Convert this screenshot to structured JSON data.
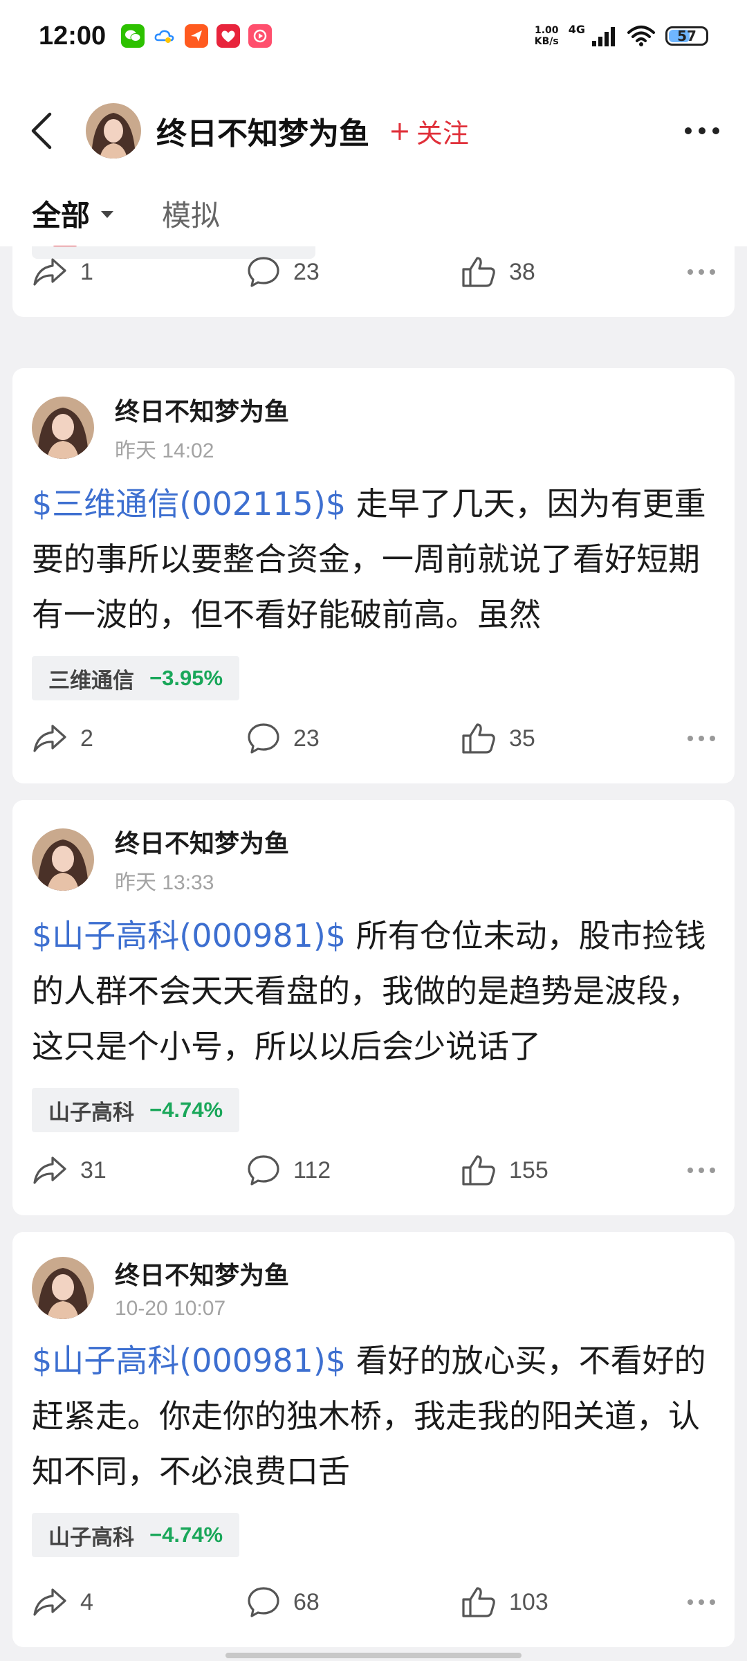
{
  "status_bar": {
    "time": "12:00",
    "net_speed_value": "1.00",
    "net_speed_unit": "KB/s",
    "network": "4G",
    "battery": "57",
    "battery_level": 0.57
  },
  "header": {
    "title": "终日不知梦为鱼",
    "follow_label": "关注",
    "follow_prefix": "+"
  },
  "tabs": [
    {
      "label": "全部",
      "active": true
    },
    {
      "label": "模拟",
      "active": false
    }
  ],
  "partial_post": {
    "shares": "1",
    "comments": "23",
    "likes": "38"
  },
  "posts": [
    {
      "author": "终日不知梦为鱼",
      "time": "昨天 14:02",
      "stock_link": "$三维通信(002115)$",
      "text": " 走早了几天，因为有更重要的事所以要整合资金，一周前就说了看好短期有一波的，但不看好能破前高。虽然",
      "tag_name": "三维通信",
      "tag_change": "−3.95%",
      "shares": "2",
      "comments": "23",
      "likes": "35"
    },
    {
      "author": "终日不知梦为鱼",
      "time": "昨天 13:33",
      "stock_link": "$山子高科(000981)$",
      "text": " 所有仓位未动，股市捡钱的人群不会天天看盘的，我做的是趋势是波段，这只是个小号，所以以后会少说话了",
      "tag_name": "山子高科",
      "tag_change": "−4.74%",
      "shares": "31",
      "comments": "112",
      "likes": "155"
    },
    {
      "author": "终日不知梦为鱼",
      "time": "10-20 10:07",
      "stock_link": "$山子高科(000981)$",
      "text": " 看好的放心买，不看好的赶紧走。你走你的独木桥，我走我的阳关道，认知不同，不必浪费口舌",
      "tag_name": "山子高科",
      "tag_change": "−4.74%",
      "shares": "4",
      "comments": "68",
      "likes": "103"
    }
  ],
  "colors": {
    "accent_red": "#e0303a",
    "stock_link_blue": "#3d6fd0",
    "change_green": "#1aa75a"
  }
}
